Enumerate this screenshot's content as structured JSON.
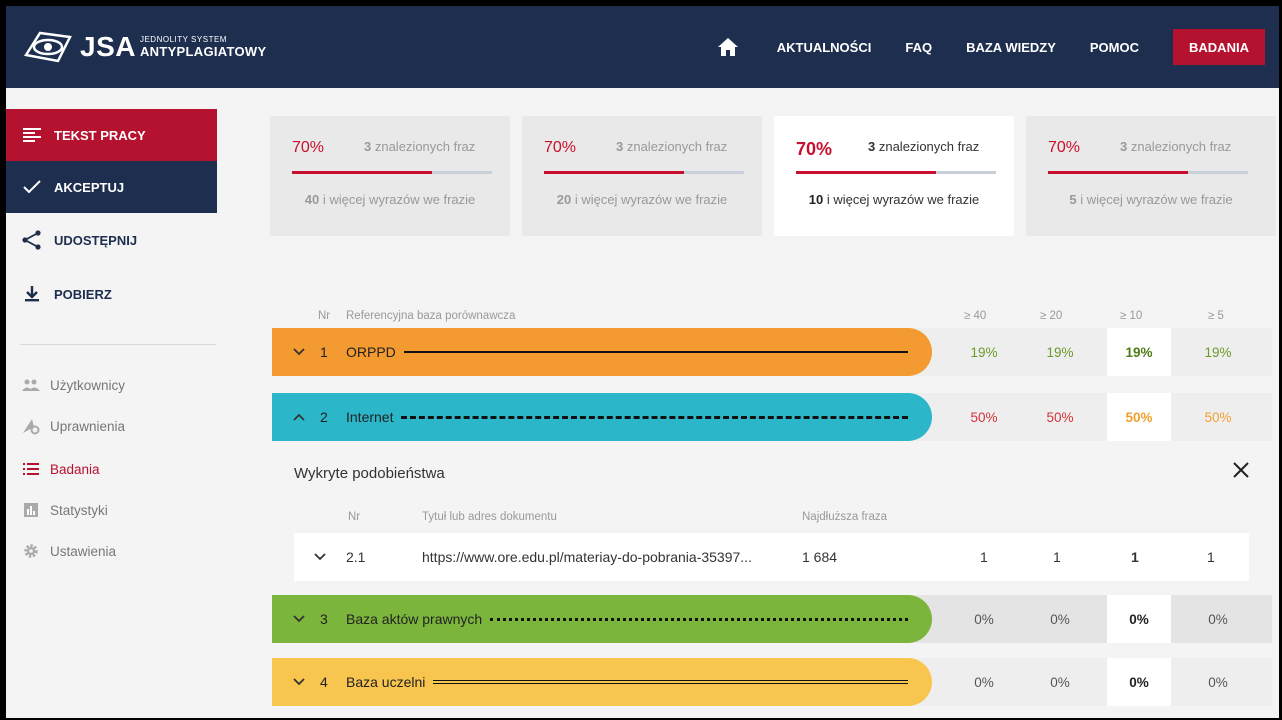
{
  "logo": {
    "brand": "JSA",
    "line1": "JEDNOLITY SYSTEM",
    "line2": "ANTYPLAGIATOWY"
  },
  "nav": {
    "items": [
      "AKTUALNOŚCI",
      "FAQ",
      "BAZA WIEDZY",
      "POMOC"
    ],
    "active": "BADANIA"
  },
  "sidebar": {
    "actions": [
      {
        "label": "TEKST PRACY",
        "icon": "list-lines-icon"
      },
      {
        "label": "AKCEPTUJ",
        "icon": "check-icon"
      },
      {
        "label": "UDOSTĘPNIJ",
        "icon": "share-icon"
      },
      {
        "label": "POBIERZ",
        "icon": "download-icon"
      }
    ],
    "links": [
      {
        "label": "Użytkownicy",
        "icon": "users-icon"
      },
      {
        "label": "Uprawnienia",
        "icon": "permissions-icon"
      },
      {
        "label": "Badania",
        "icon": "list-icon"
      },
      {
        "label": "Statystyki",
        "icon": "stats-icon"
      },
      {
        "label": "Ustawienia",
        "icon": "gear-icon"
      }
    ]
  },
  "cards": [
    {
      "pct": "70%",
      "found_num": "3",
      "found_text": " znalezionych fraz",
      "words_num": "40",
      "words_text": " i więcej wyrazów we frazie",
      "progress": 0.7
    },
    {
      "pct": "70%",
      "found_num": "3",
      "found_text": " znalezionych fraz",
      "words_num": "20",
      "words_text": " i więcej wyrazów we frazie",
      "progress": 0.7
    },
    {
      "pct": "70%",
      "found_num": "3",
      "found_text": " znalezionych fraz",
      "words_num": "10",
      "words_text": " i więcej wyrazów we frazie",
      "progress": 0.7
    },
    {
      "pct": "70%",
      "found_num": "3",
      "found_text": " znalezionych fraz",
      "words_num": "5",
      "words_text": " i więcej wyrazów we frazie",
      "progress": 0.7
    }
  ],
  "table": {
    "headers": {
      "nr": "Nr",
      "db": "Referencyjna baza porównawcza",
      "c40": "≥ 40",
      "c20": "≥ 20",
      "c10": "≥ 10",
      "c5": "≥ 5"
    },
    "rows": [
      {
        "nr": "1",
        "name": "ORPPD",
        "values": [
          "19%",
          "19%",
          "19%",
          "19%"
        ],
        "color": "#f39a31",
        "line": "solid",
        "value_color": "#6a9a2a"
      },
      {
        "nr": "2",
        "name": "Internet",
        "values": [
          "50%",
          "50%",
          "50%",
          "50%"
        ],
        "color": "#2bb7c9",
        "line": "dashed",
        "value_color": "#d0343a"
      },
      {
        "nr": "3",
        "name": "Baza aktów prawnych",
        "values": [
          "0%",
          "0%",
          "0%",
          "0%"
        ],
        "color": "#7cb53c",
        "line": "dotted",
        "value_color": "#555"
      },
      {
        "nr": "4",
        "name": "Baza uczelni",
        "values": [
          "0%",
          "0%",
          "0%",
          "0%"
        ],
        "color": "#f8c54f",
        "line": "double",
        "value_color": "#555"
      }
    ]
  },
  "panel": {
    "title": "Wykryte podobieństwa",
    "headers": {
      "nr": "Nr",
      "title": "Tytuł lub adres dokumentu",
      "longest": "Najdłuższa fraza"
    },
    "row": {
      "nr": "2.1",
      "url": "https://www.ore.edu.pl/materiay-do-pobrania-35397...",
      "longest": "1 684",
      "values": [
        "1",
        "1",
        "1",
        "1"
      ]
    }
  },
  "colors": {
    "navy": "#1d2e4e",
    "red": "#b5122f",
    "accent_red": "#c8102e"
  }
}
